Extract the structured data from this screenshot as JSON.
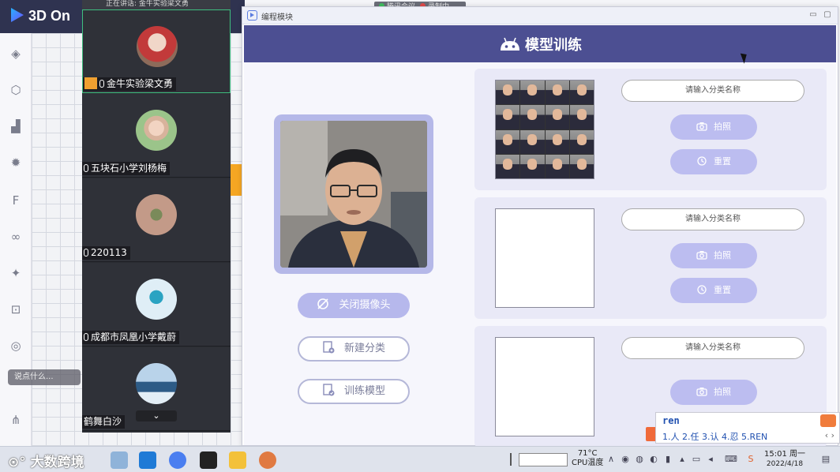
{
  "bg_app": {
    "logo": "3D On",
    "tools": [
      "cube-icon",
      "hexagon-icon",
      "chart-icon",
      "gear-icon",
      "font-icon",
      "link-icon",
      "run-icon",
      "scan-icon",
      "target-icon",
      "network-icon"
    ],
    "chat_placeholder": "说点什么..."
  },
  "meeting": {
    "top_text": "正在讲话: 金牛实验梁文勇",
    "participants": [
      {
        "name": "金牛实验梁文勇",
        "host": true,
        "active": true
      },
      {
        "name": "五块石小学刘杨梅"
      },
      {
        "name": "220113"
      },
      {
        "name": "成都市凤凰小学戴蔚"
      },
      {
        "name": "鹤舞白沙"
      }
    ],
    "more": "⌄",
    "indicator": {
      "left": "腾讯会议",
      "right": "录制中"
    }
  },
  "window": {
    "title": "编程模块",
    "header": "模型训练",
    "buttons": {
      "close_camera": "关闭摄像头",
      "new_class": "新建分类",
      "train_model": "训练模型"
    },
    "cards": [
      {
        "placeholder": "请输入分类名称",
        "capture": "拍照",
        "reset": "重置",
        "has_images": true
      },
      {
        "placeholder": "请输入分类名称",
        "capture": "拍照",
        "reset": "重置",
        "has_images": false
      },
      {
        "placeholder": "请输入分类名称",
        "capture": "拍照",
        "has_images": false
      }
    ]
  },
  "ime": {
    "input": "ren",
    "candidates": "1.人  2.任  3.认  4.忍  5.REN",
    "nav": "‹ ›"
  },
  "taskbar": {
    "watermark": "大数跨境",
    "temp": "71°C",
    "temp_label": "CPU温度",
    "time": "15:01 周一",
    "date": "2022/4/18"
  },
  "colors": {
    "header": "#4c4f92",
    "accent_button": "#b6b8ec",
    "card_bg": "#e9e9f7"
  }
}
